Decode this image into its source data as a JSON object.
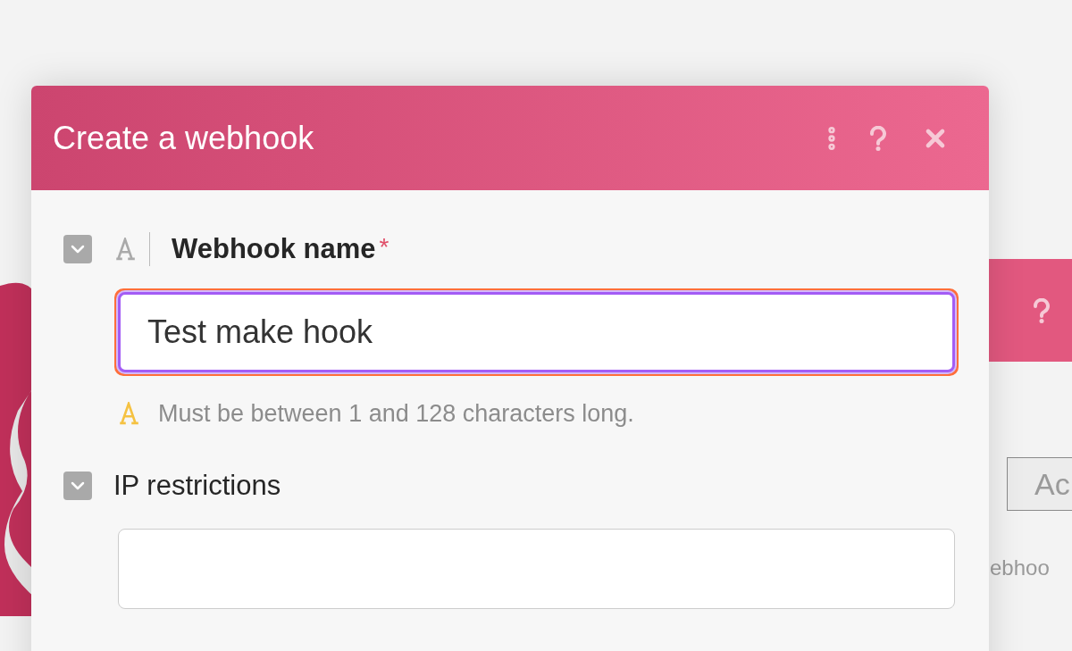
{
  "background_panel": {
    "tab_label": "Ac",
    "caption": "ebhoo"
  },
  "dialog": {
    "title": "Create a webhook",
    "fields": [
      {
        "kind": "text",
        "label": "Webhook name",
        "required_mark": "*",
        "focused": true,
        "value": "Test make hook",
        "hint": "Must be between 1 and 128 characters long."
      },
      {
        "kind": "plain",
        "label": "IP restrictions",
        "focused": false
      }
    ]
  }
}
